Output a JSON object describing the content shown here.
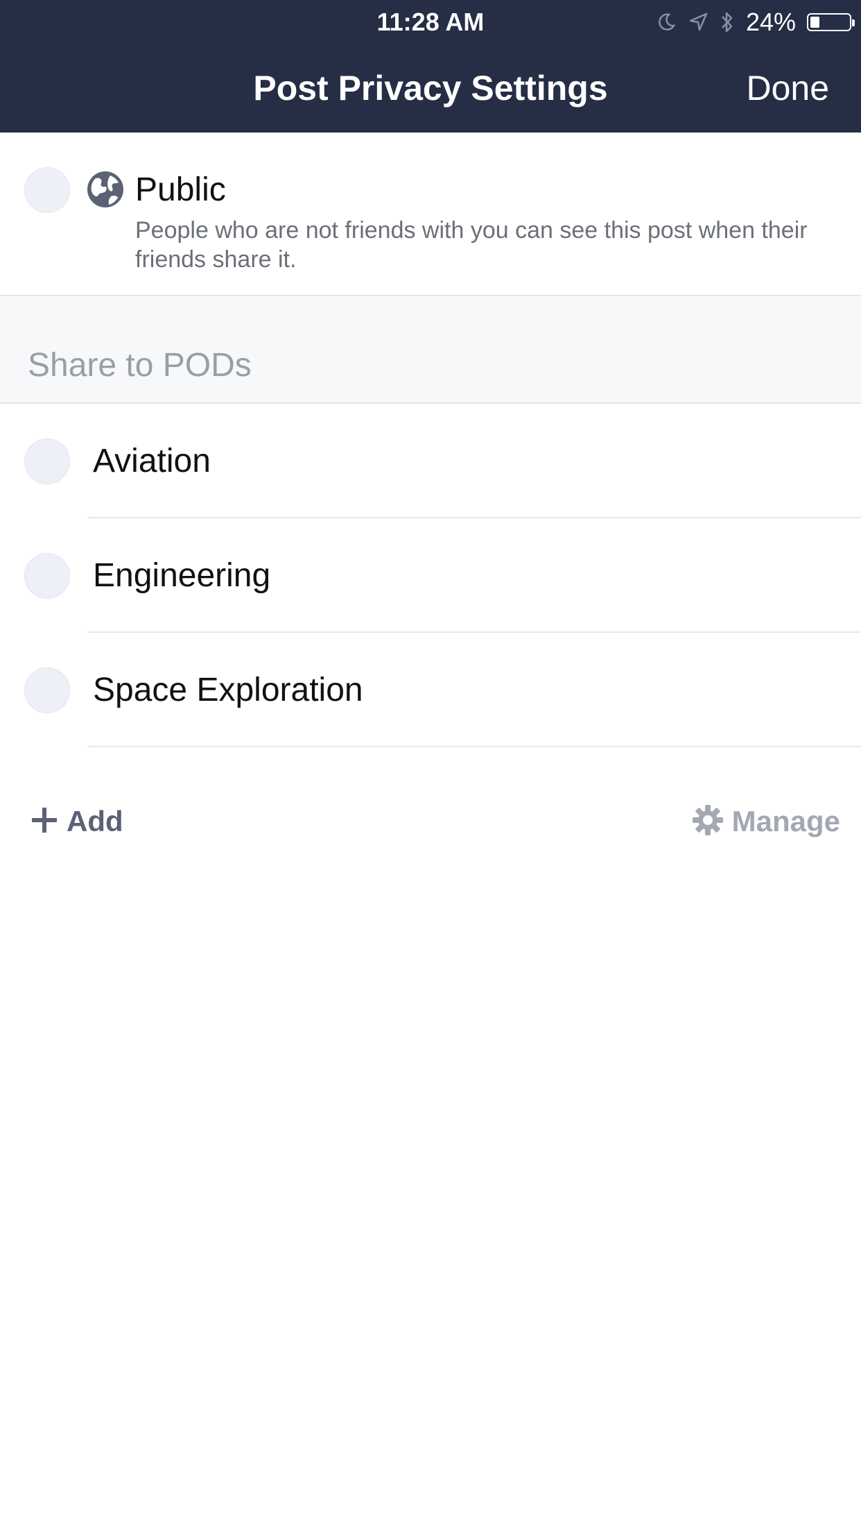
{
  "status_bar": {
    "time": "11:28 AM",
    "battery_percent": "24%",
    "battery_level": 0.24,
    "icons": [
      "moon-icon",
      "location-arrow-icon",
      "bluetooth-icon",
      "battery-icon"
    ]
  },
  "nav": {
    "title": "Post Privacy Settings",
    "done_label": "Done"
  },
  "public_option": {
    "title": "Public",
    "description": "People who are not friends with you can see this post when their friends share it.",
    "icon": "globe-icon"
  },
  "section": {
    "label": "Share to PODs"
  },
  "pods": [
    {
      "label": "Aviation"
    },
    {
      "label": "Engineering"
    },
    {
      "label": "Space Exploration"
    }
  ],
  "actions": {
    "add_label": "Add",
    "manage_label": "Manage"
  },
  "colors": {
    "header_bg": "#252e44",
    "radio_fill": "#edf0f6",
    "section_bg": "#f7f8fa"
  }
}
